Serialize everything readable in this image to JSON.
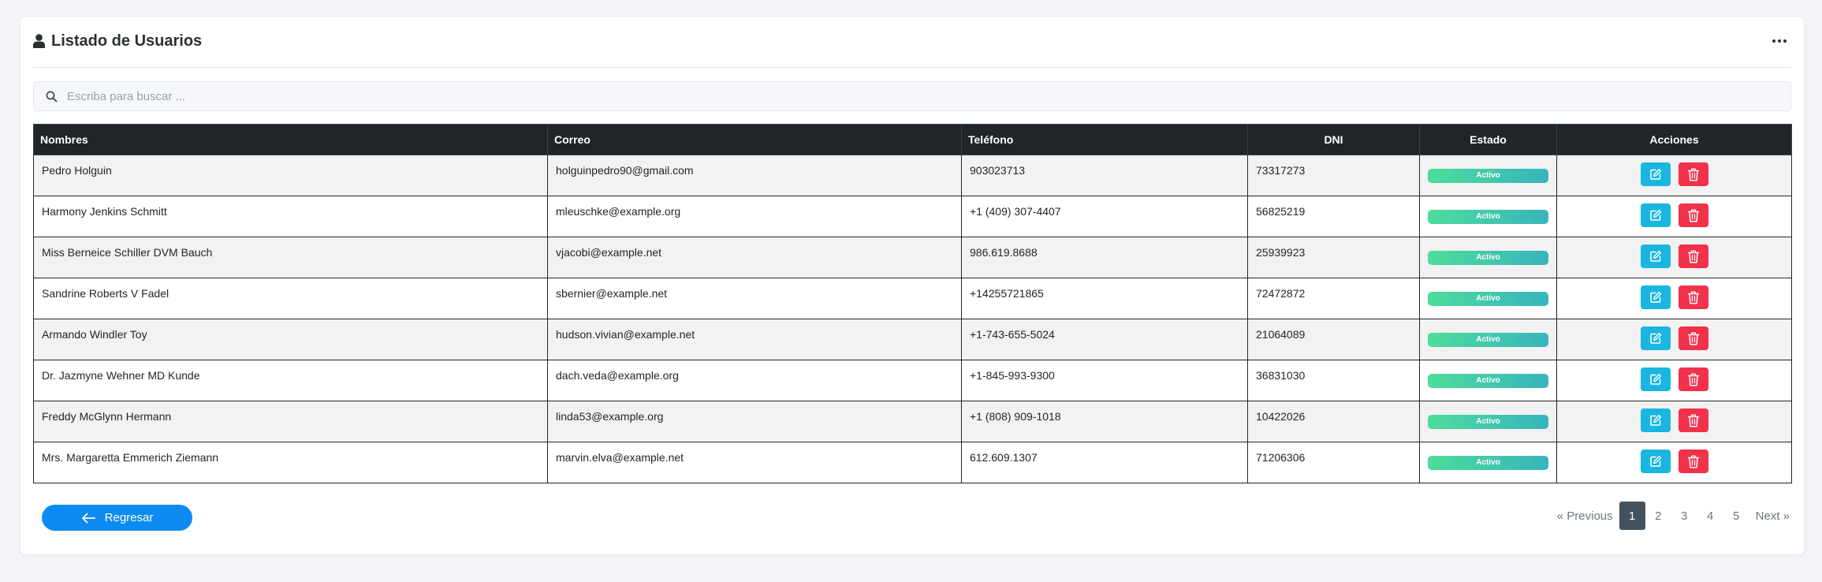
{
  "header": {
    "title": "Listado de Usuarios",
    "more_icon": "ellipsis-horizontal-icon"
  },
  "search": {
    "placeholder": "Escriba para buscar ...",
    "value": ""
  },
  "table": {
    "columns": {
      "nombres": "Nombres",
      "correo": "Correo",
      "telefono": "Teléfono",
      "dni": "DNI",
      "estado": "Estado",
      "acciones": "Acciones"
    },
    "rows": [
      {
        "nombres": "Pedro Holguin",
        "correo": "holguinpedro90@gmail.com",
        "telefono": "903023713",
        "dni": "73317273",
        "estado": "Activo"
      },
      {
        "nombres": "Harmony Jenkins Schmitt",
        "correo": "mleuschke@example.org",
        "telefono": "+1 (409) 307-4407",
        "dni": "56825219",
        "estado": "Activo"
      },
      {
        "nombres": "Miss Berneice Schiller DVM Bauch",
        "correo": "vjacobi@example.net",
        "telefono": "986.619.8688",
        "dni": "25939923",
        "estado": "Activo"
      },
      {
        "nombres": "Sandrine Roberts V Fadel",
        "correo": "sbernier@example.net",
        "telefono": "+14255721865",
        "dni": "72472872",
        "estado": "Activo"
      },
      {
        "nombres": "Armando Windler Toy",
        "correo": "hudson.vivian@example.net",
        "telefono": "+1-743-655-5024",
        "dni": "21064089",
        "estado": "Activo"
      },
      {
        "nombres": "Dr. Jazmyne Wehner MD Kunde",
        "correo": "dach.veda@example.org",
        "telefono": "+1-845-993-9300",
        "dni": "36831030",
        "estado": "Activo"
      },
      {
        "nombres": "Freddy McGlynn Hermann",
        "correo": "linda53@example.org",
        "telefono": "+1 (808) 909-1018",
        "dni": "10422026",
        "estado": "Activo"
      },
      {
        "nombres": "Mrs. Margaretta Emmerich Ziemann",
        "correo": "marvin.elva@example.net",
        "telefono": "612.609.1307",
        "dni": "71206306",
        "estado": "Activo"
      }
    ]
  },
  "footer": {
    "back_label": "Regresar",
    "pagination": {
      "previous": "« Previous",
      "pages": [
        "1",
        "2",
        "3",
        "4",
        "5"
      ],
      "current": "1",
      "next": "Next »"
    }
  },
  "colors": {
    "header_bg": "#212529",
    "badge_from": "#4ddd9a",
    "badge_to": "#38b4bd",
    "edit_button": "#1ab6e0",
    "delete_button": "#f2314a",
    "back_button": "#0d8bf2",
    "active_page": "#44525e"
  }
}
